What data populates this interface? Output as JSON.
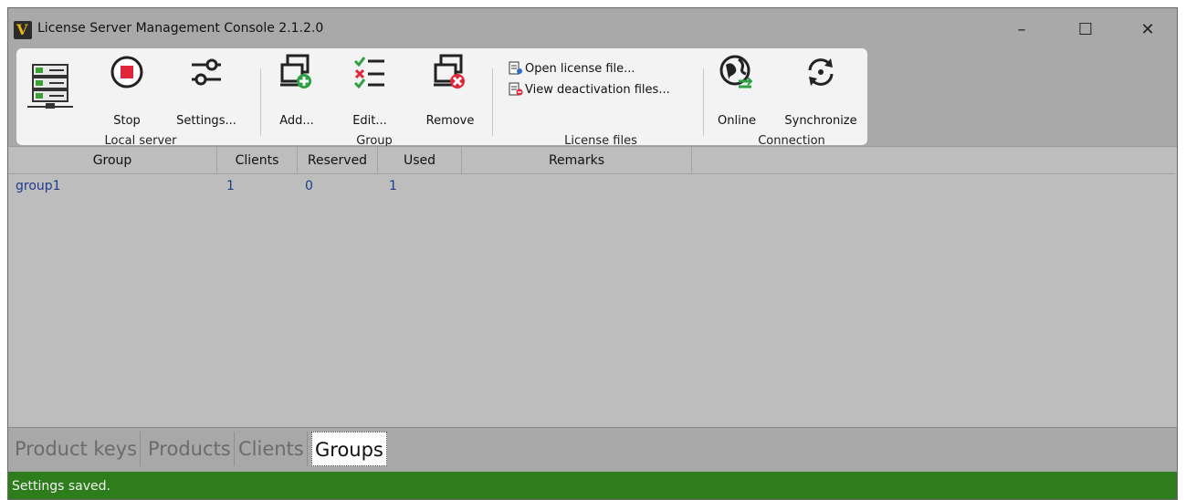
{
  "window": {
    "title": "License Server Management Console 2.1.2.0",
    "minimize_glyph": "–",
    "maximize_glyph": "☐",
    "close_glyph": "✕"
  },
  "ribbon": {
    "local_server": {
      "caption": "Local server",
      "stop_label": "Stop",
      "settings_label": "Settings..."
    },
    "group": {
      "caption": "Group",
      "add_label": "Add...",
      "edit_label": "Edit...",
      "remove_label": "Remove"
    },
    "license_files": {
      "caption": "License files",
      "open_label": "Open license file...",
      "view_label": "View deactivation files..."
    },
    "connection": {
      "caption": "Connection",
      "online_label": "Online",
      "sync_label": "Synchronize"
    }
  },
  "grid": {
    "columns": [
      "Group",
      "Clients",
      "Reserved",
      "Used",
      "Remarks"
    ],
    "rows": [
      {
        "group": "group1",
        "clients": "1",
        "reserved": "0",
        "used": "1",
        "remarks": ""
      }
    ]
  },
  "tabs": [
    {
      "label": "Product keys",
      "active": false
    },
    {
      "label": "Products",
      "active": false
    },
    {
      "label": "Clients",
      "active": false
    },
    {
      "label": "Groups",
      "active": true
    }
  ],
  "status": {
    "text": "Settings saved."
  },
  "colors": {
    "status_green": "#2d7d1c",
    "row_text": "#1f3b8c"
  }
}
